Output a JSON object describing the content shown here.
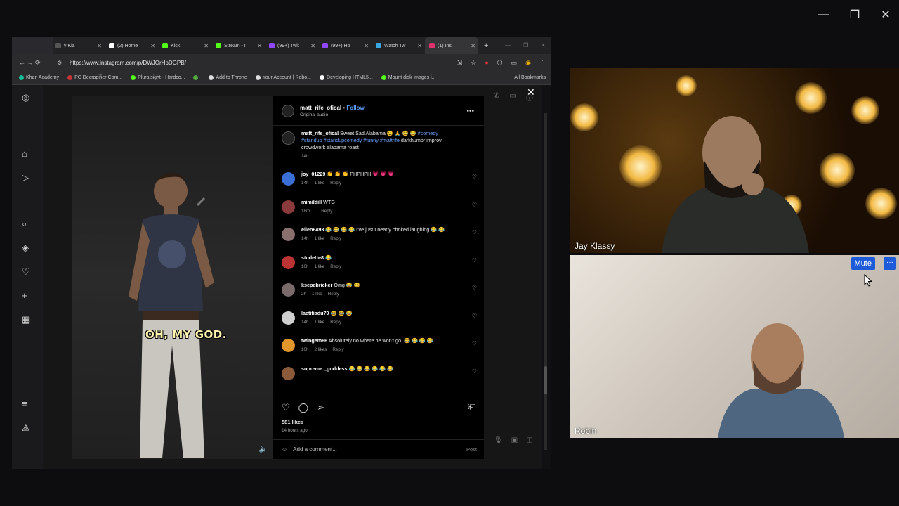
{
  "window_controls": {
    "minimize": "—",
    "restore": "❐",
    "close": "✕"
  },
  "browser": {
    "tabs": [
      {
        "label": "y Kla",
        "color": "#555"
      },
      {
        "label": "(2) Home",
        "color": "#fff"
      },
      {
        "label": "Kick",
        "color": "#53fc18"
      },
      {
        "label": "Stream - I",
        "color": "#53fc18"
      },
      {
        "label": "(99+) Twit",
        "color": "#9146ff"
      },
      {
        "label": "(99+) Ho",
        "color": "#9146ff"
      },
      {
        "label": "Watch Tw",
        "color": "#3aa7e3"
      },
      {
        "label": "(1) Ins",
        "color": "#e1306c",
        "active": true
      }
    ],
    "new_tab": "+",
    "url": "https://www.instagram.com/p/DWJOrHpDGPB/",
    "bookmarks": [
      {
        "label": "Khan Academy",
        "color": "#14bf96"
      },
      {
        "label": "PC Decrapifier Com...",
        "color": "#c33"
      },
      {
        "label": "Pluralsight - Hardco...",
        "color": "#53fc18"
      },
      {
        "label": "",
        "color": "#53a93f"
      },
      {
        "label": "Add to Throne",
        "color": "#ddd"
      },
      {
        "label": "Your Account | Robo...",
        "color": "#ddd"
      },
      {
        "label": "Developing HTML5...",
        "color": "#fff"
      },
      {
        "label": "Mount disk images i...",
        "color": "#53fc18"
      }
    ],
    "all_bookmarks": "All Bookmarks"
  },
  "post": {
    "author": "matt_rife_ofical",
    "follow": "Follow",
    "sep": "•",
    "audio": "Original audio",
    "caption_text": "Sweet Sad Alabama 😮 🙏 😂 😂",
    "caption_tags": "#comedy #standup #standupcomedy #funny #mattrife",
    "caption_tail": "darkhumor improv crowdwork alabama roast",
    "caption_time": "14h",
    "video_caption": "OH, MY GOD.",
    "likes": "581 likes",
    "time_ago": "14 hours ago",
    "add_comment": "Add a comment...",
    "post_btn": "Post"
  },
  "comments": [
    {
      "user": "joy_01229",
      "text": "👏 👏 👏 PHPHPH 💗 💗 💗",
      "time": "14h",
      "likes": "1 like",
      "reply": "Reply",
      "color": "#3a6fd8"
    },
    {
      "user": "mimildill",
      "text": "WTG",
      "time": "18m",
      "likes": "",
      "reply": "Reply",
      "color": "#8a3a3a"
    },
    {
      "user": "ellen6493",
      "text": "😂 😂 😂 😂 I've just I nearly choked laughing 😂 😂",
      "time": "14h",
      "likes": "1 like",
      "reply": "Reply",
      "color": "#8a6f6f"
    },
    {
      "user": "studette8",
      "text": "😂",
      "time": "10h",
      "likes": "1 like",
      "reply": "Reply",
      "color": "#b33"
    },
    {
      "user": "ksepebricker",
      "text": "Omg 😂 🥴",
      "time": "2h",
      "likes": "1 like",
      "reply": "Reply",
      "color": "#7a6a6a"
    },
    {
      "user": "laetitiadu79",
      "text": "😂 😂 😂",
      "time": "14h",
      "likes": "1 like",
      "reply": "Reply",
      "color": "#cfcfcf"
    },
    {
      "user": "twingem66",
      "text": "Absolutely no where he won't go. 😂 😂 😂 😂",
      "time": "10h",
      "likes": "2 likes",
      "reply": "Reply",
      "color": "#e0962a"
    },
    {
      "user": "supreme._goddess",
      "text": "😂 😂 😂 😂 😂 😂",
      "time": "",
      "likes": "",
      "reply": "",
      "color": "#8a5a3a"
    }
  ],
  "call": {
    "participant1": "Jay Klassy",
    "participant2": "Robin",
    "mute": "Mute",
    "more": "···"
  }
}
